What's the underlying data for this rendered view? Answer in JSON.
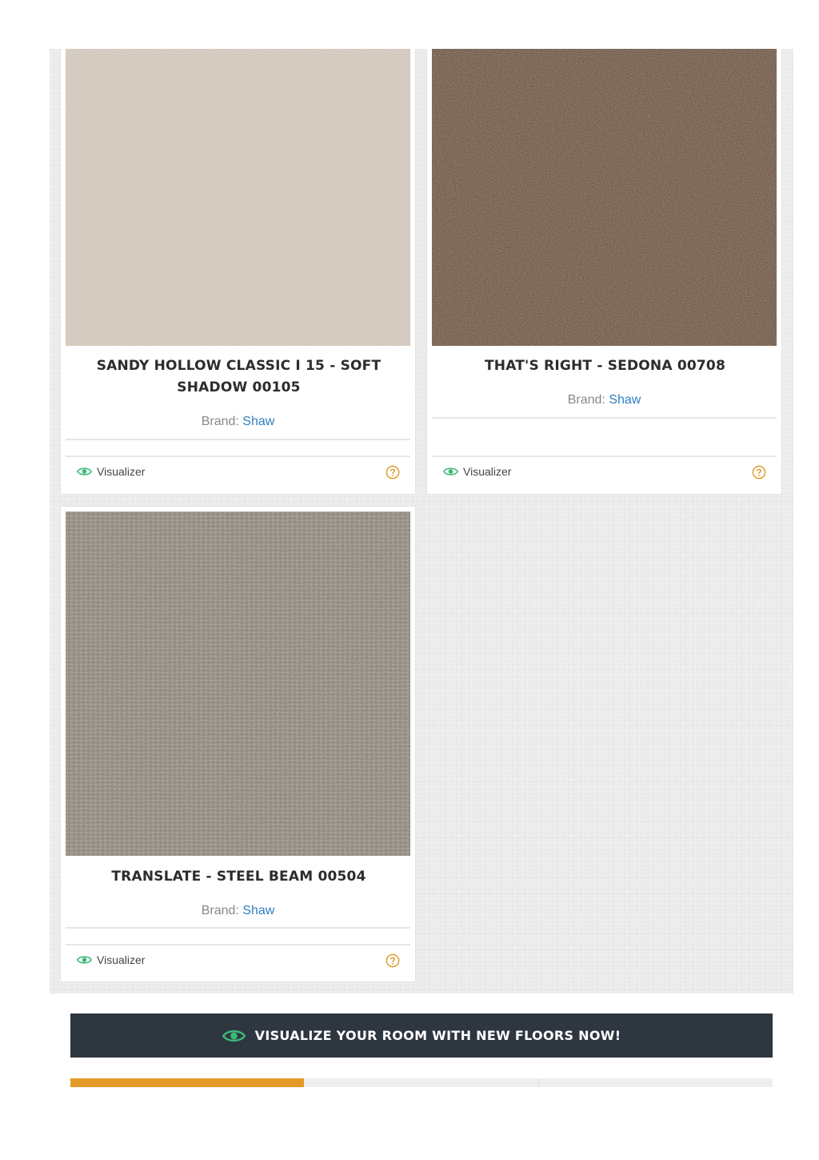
{
  "products": [
    {
      "title": "SANDY HOLLOW CLASSIC I 15 - SOFT SHADOW 00105",
      "brand_label": "Brand:",
      "brand_name": "Shaw",
      "visualizer_label": "Visualizer",
      "swatch_color": "#cfc3b6",
      "swatch_icon": "carpet-swatch-beige"
    },
    {
      "title": "THAT'S RIGHT - SEDONA 00708",
      "brand_label": "Brand:",
      "brand_name": "Shaw",
      "visualizer_label": "Visualizer",
      "swatch_color": "#6b5241",
      "swatch_icon": "carpet-swatch-brown"
    },
    {
      "title": "TRANSLATE - STEEL BEAM 00504",
      "brand_label": "Brand:",
      "brand_name": "Shaw",
      "visualizer_label": "Visualizer",
      "swatch_color": "#8d867c",
      "swatch_icon": "carpet-swatch-gray"
    }
  ],
  "cta": {
    "label": "VISUALIZE YOUR ROOM WITH NEW FLOORS NOW!",
    "icon": "eye-icon"
  },
  "colors": {
    "accent": "#e49a28",
    "visualizer_icon": "#3cb878",
    "help_icon": "#e09a25",
    "brand_link": "#2f7fc1",
    "cta_bg": "#2e3640"
  }
}
